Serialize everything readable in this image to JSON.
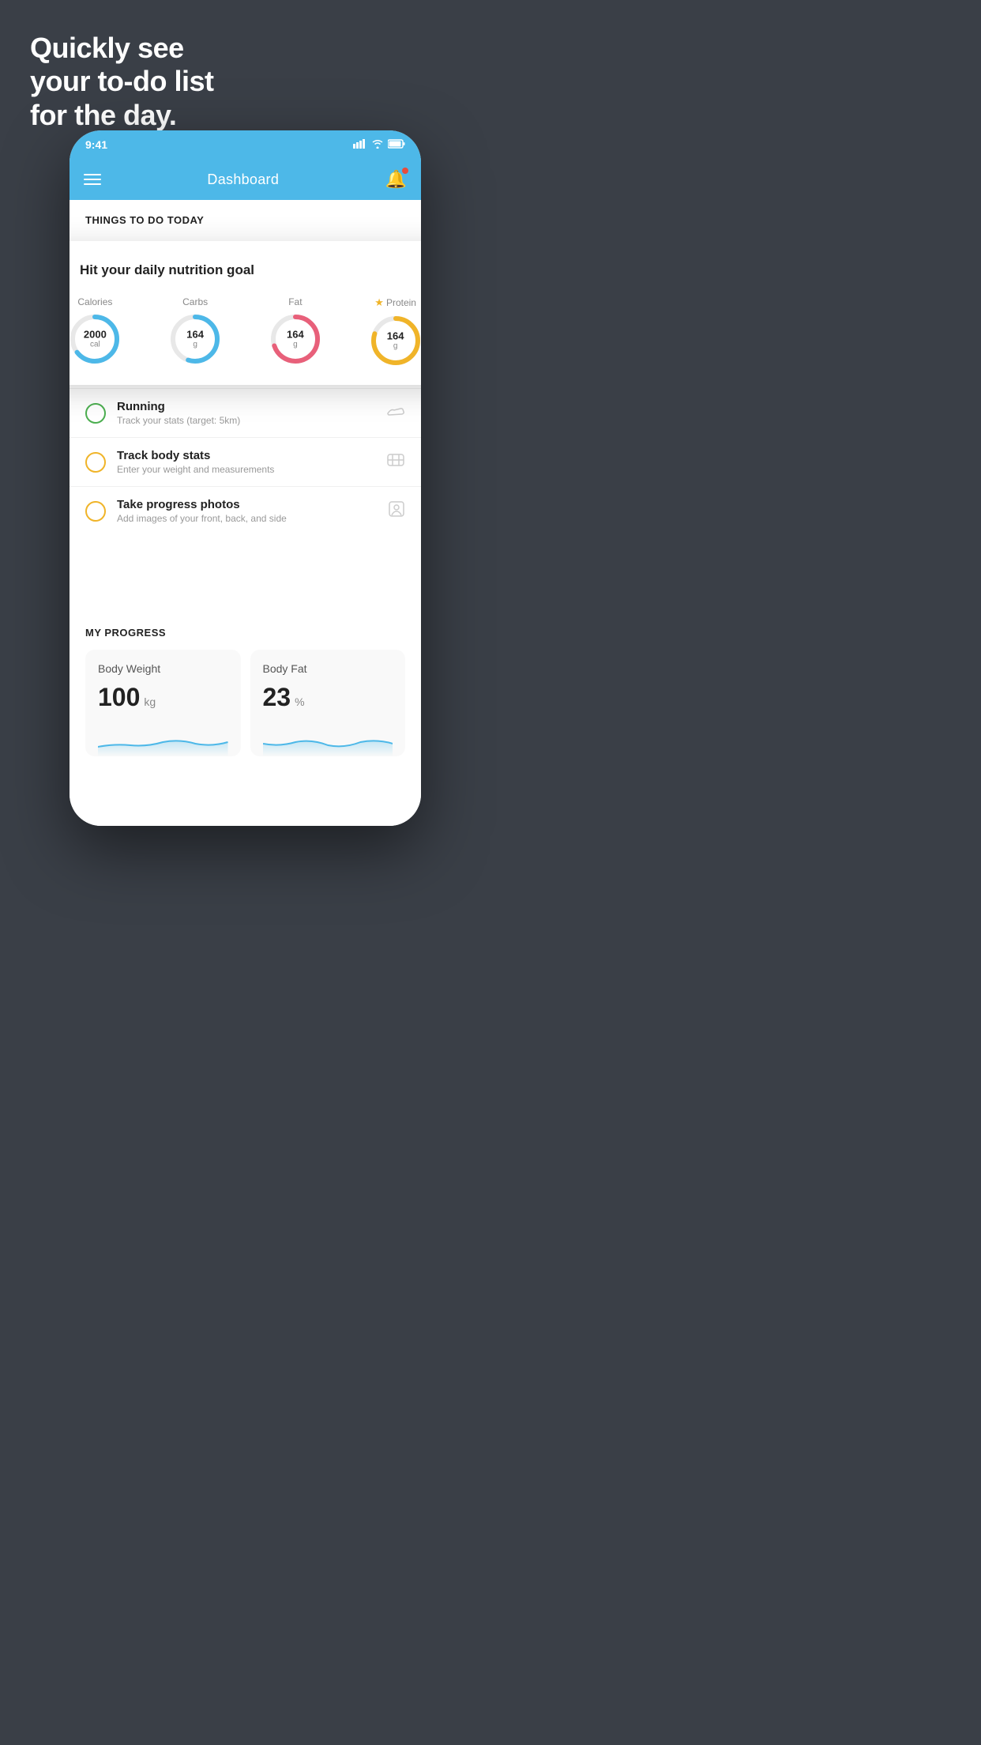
{
  "hero": {
    "line1": "Quickly see",
    "line2": "your to-do list",
    "line3": "for the day."
  },
  "statusBar": {
    "time": "9:41",
    "signal": "▋▋▋▋",
    "wifi": "wifi",
    "battery": "battery"
  },
  "navBar": {
    "title": "Dashboard"
  },
  "floatingCard": {
    "title": "Hit your daily nutrition goal",
    "items": [
      {
        "label": "Calories",
        "value": "2000",
        "unit": "cal",
        "color": "#4db8e8",
        "percent": 65
      },
      {
        "label": "Carbs",
        "value": "164",
        "unit": "g",
        "color": "#4db8e8",
        "percent": 55
      },
      {
        "label": "Fat",
        "value": "164",
        "unit": "g",
        "color": "#e8607a",
        "percent": 70
      },
      {
        "label": "Protein",
        "value": "164",
        "unit": "g",
        "color": "#f0b429",
        "percent": 80,
        "starred": true
      }
    ]
  },
  "todoItems": [
    {
      "id": 1,
      "title": "Running",
      "sub": "Track your stats (target: 5km)",
      "circleColor": "green"
    },
    {
      "id": 2,
      "title": "Track body stats",
      "sub": "Enter your weight and measurements",
      "circleColor": "yellow"
    },
    {
      "id": 3,
      "title": "Take progress photos",
      "sub": "Add images of your front, back, and side",
      "circleColor": "yellow"
    }
  ],
  "progressSection": {
    "header": "MY PROGRESS",
    "cards": [
      {
        "title": "Body Weight",
        "value": "100",
        "unit": "kg"
      },
      {
        "title": "Body Fat",
        "value": "23",
        "unit": "%"
      }
    ]
  }
}
